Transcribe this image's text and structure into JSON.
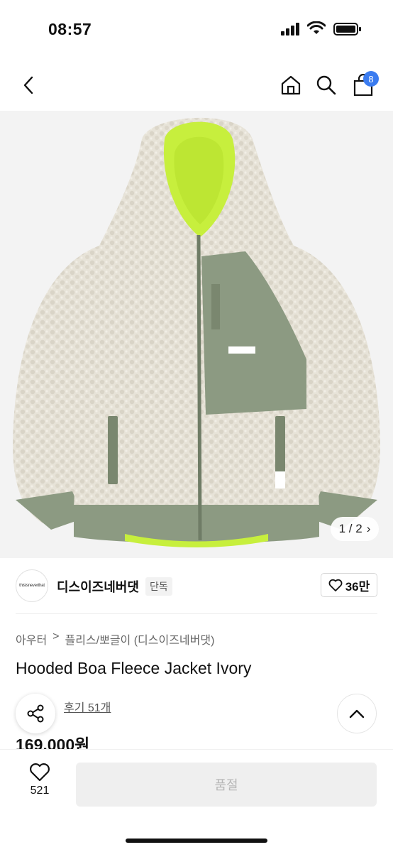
{
  "status": {
    "time": "08:57"
  },
  "nav": {
    "cart_count": "8"
  },
  "image": {
    "pager_current": "1 / 2",
    "pager_arrow": "›"
  },
  "brand": {
    "logo_text": "thisisneverthat",
    "name": "디스이즈네버댓",
    "tag": "단독",
    "likes": "36만"
  },
  "breadcrumb": {
    "category": "아우터",
    "separator": ">",
    "subcategory": "플리스/뽀글이 (디스이즈네버댓)"
  },
  "product": {
    "title": "Hooded Boa Fleece Jacket Ivory",
    "review_label": "후기 51개",
    "price": "169,000원"
  },
  "bottom": {
    "wish_count": "521",
    "buy_label": "품절"
  },
  "colors": {
    "accent": "#3b7cf0",
    "fleece": "#e7e3d8",
    "olive": "#8c9a82",
    "lime": "#c7ef3d"
  }
}
